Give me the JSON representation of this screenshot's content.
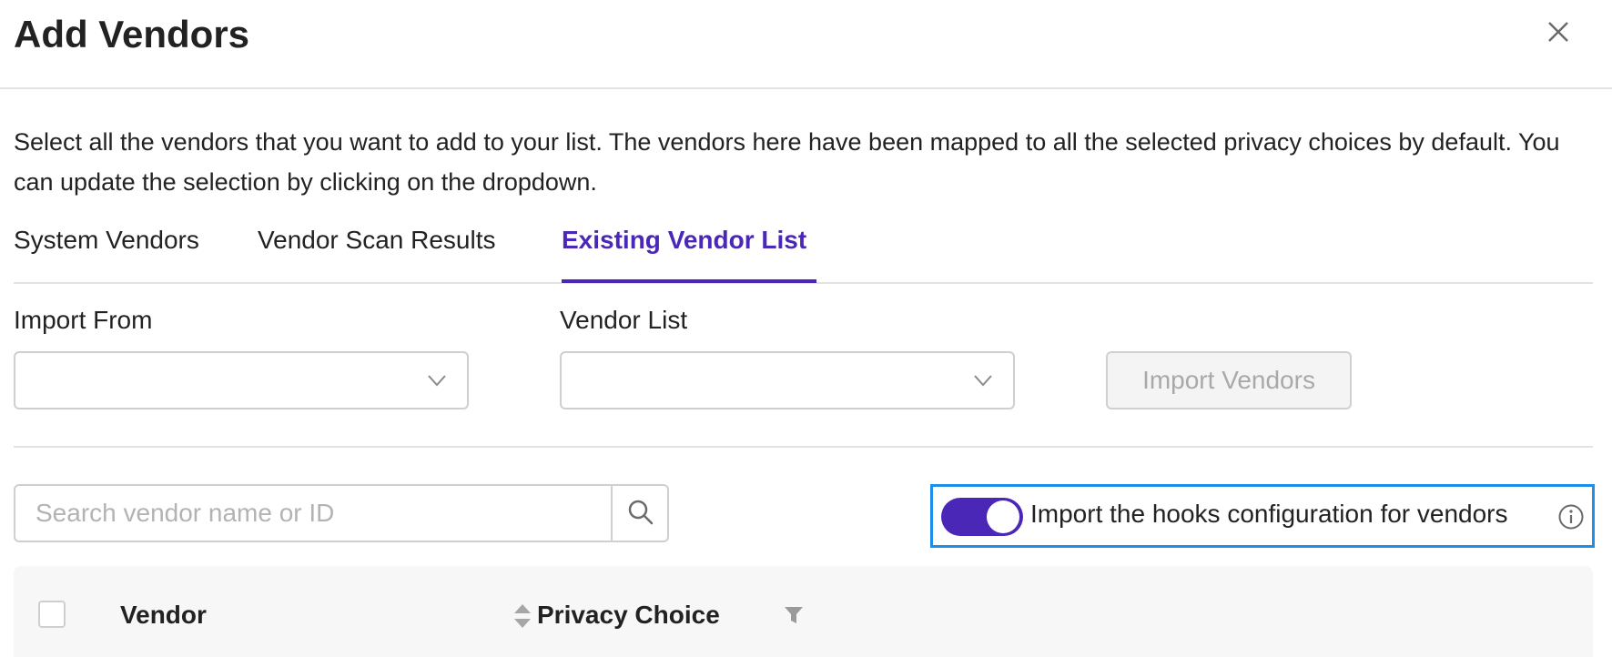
{
  "modal": {
    "title": "Add Vendors",
    "description": "Select all the vendors that you want to add to your list. The vendors here have been mapped to all the selected privacy choices by default. You can update the selection by clicking on the dropdown."
  },
  "tabs": [
    {
      "label": "System Vendors",
      "active": false
    },
    {
      "label": "Vendor Scan Results",
      "active": false
    },
    {
      "label": "Existing Vendor List",
      "active": true
    }
  ],
  "import_from": {
    "label": "Import From",
    "value": ""
  },
  "vendor_list": {
    "label": "Vendor List",
    "value": ""
  },
  "import_button": {
    "label": "Import Vendors",
    "disabled": true
  },
  "search": {
    "placeholder": "Search vendor name or ID",
    "value": ""
  },
  "hooks_toggle": {
    "label": "Import the hooks configuration for vendors",
    "on": true
  },
  "table": {
    "columns": [
      {
        "label": "Vendor",
        "icon": "sort-icon"
      },
      {
        "label": "Privacy Choice",
        "icon": "filter-icon"
      }
    ]
  },
  "colors": {
    "accent": "#4a27b6",
    "highlight_border": "#1e8fe8"
  }
}
